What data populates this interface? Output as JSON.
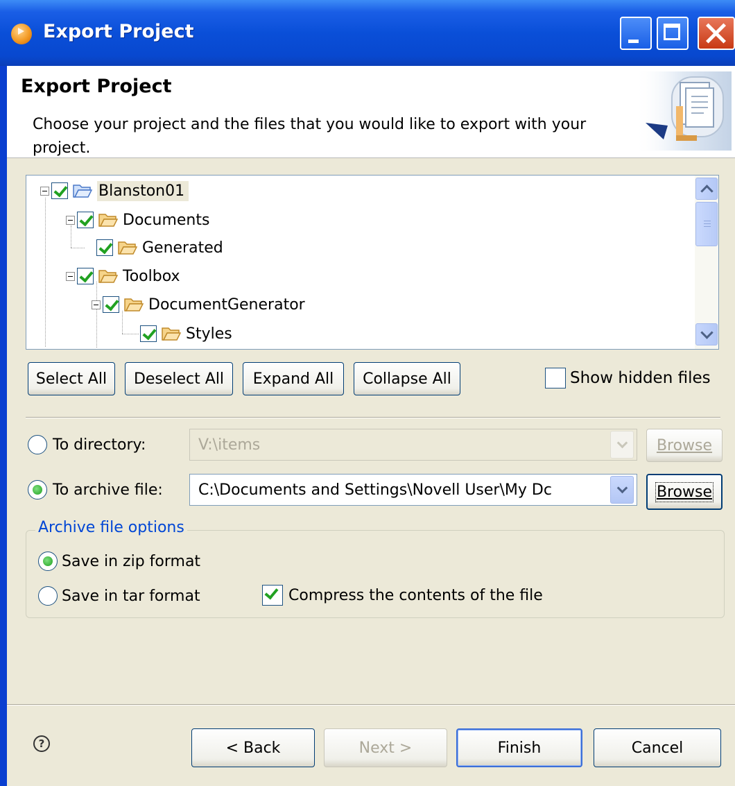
{
  "window": {
    "title": "Export Project"
  },
  "header": {
    "title": "Export Project",
    "description": "Choose your project and the files that you would like to export with your project."
  },
  "tree": {
    "items": [
      {
        "label": "Blanston01",
        "checked": true,
        "expanded": true
      },
      {
        "label": "Documents",
        "checked": true,
        "expanded": true
      },
      {
        "label": "Generated",
        "checked": true
      },
      {
        "label": "Toolbox",
        "checked": true,
        "expanded": true
      },
      {
        "label": "DocumentGenerator",
        "checked": true,
        "expanded": true
      },
      {
        "label": "Styles",
        "checked": true
      }
    ]
  },
  "tree_buttons": {
    "select_all": "Select All",
    "deselect_all": "Deselect All",
    "expand_all": "Expand All",
    "collapse_all": "Collapse All"
  },
  "show_hidden": {
    "label": "Show hidden files",
    "checked": false
  },
  "destination": {
    "directory_label": "To directory:",
    "directory_value": "V:\\items",
    "directory_selected": false,
    "archive_label": "To archive file:",
    "archive_value": "C:\\Documents and Settings\\Novell User\\My Dc",
    "archive_selected": true,
    "browse_label": "Browse"
  },
  "archive_options": {
    "legend": "Archive file options",
    "zip_label": "Save in zip format",
    "zip_selected": true,
    "tar_label": "Save in tar format",
    "tar_selected": false,
    "compress_label": "Compress the contents of the file",
    "compress_checked": true
  },
  "footer": {
    "help_symbol": "?",
    "back_label": "< Back",
    "next_label": "Next >",
    "finish_label": "Finish",
    "cancel_label": "Cancel"
  },
  "colors": {
    "titlebar": "#0a4fd8",
    "dialog_bg": "#ece9d8",
    "legend_text": "#0046d5",
    "check_green": "#21a121"
  }
}
